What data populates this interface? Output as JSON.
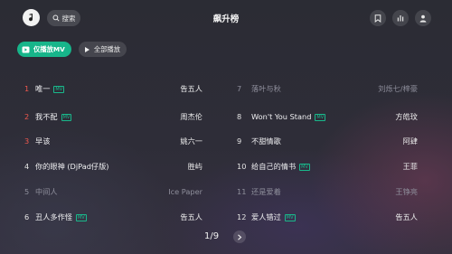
{
  "header": {
    "title": "飙升榜",
    "search_label": "搜索"
  },
  "controls": {
    "mv_only_label": "仅播放MV",
    "play_all_label": "全部播放"
  },
  "mv_badge": "MV",
  "colors": {
    "accent": "#17b58a",
    "hot_rank": "#f0584e",
    "dim_text": "#8f8f9c"
  },
  "songs_left": [
    {
      "rank": "1",
      "title": "唯一",
      "artist": "告五人",
      "mv": true,
      "dim": false
    },
    {
      "rank": "2",
      "title": "我不配",
      "artist": "周杰伦",
      "mv": true,
      "dim": false
    },
    {
      "rank": "3",
      "title": "早该",
      "artist": "姚六一",
      "mv": false,
      "dim": false
    },
    {
      "rank": "4",
      "title": "你的眼神 (DjPad仔版)",
      "artist": "胜屿",
      "mv": false,
      "dim": false
    },
    {
      "rank": "5",
      "title": "中间人",
      "artist": "Ice Paper",
      "mv": false,
      "dim": true
    },
    {
      "rank": "6",
      "title": "丑人多作怪",
      "artist": "告五人",
      "mv": true,
      "dim": false
    }
  ],
  "songs_right": [
    {
      "rank": "7",
      "title": "落叶与秋",
      "artist": "刘烁七/梓豪",
      "mv": false,
      "dim": true
    },
    {
      "rank": "8",
      "title": "Won't You Stand",
      "artist": "方皓玟",
      "mv": true,
      "dim": false
    },
    {
      "rank": "9",
      "title": "不甜情歌",
      "artist": "阿肆",
      "mv": false,
      "dim": false
    },
    {
      "rank": "10",
      "title": "给自己的情书",
      "artist": "王菲",
      "mv": true,
      "dim": false
    },
    {
      "rank": "11",
      "title": "还是爱着",
      "artist": "王铮亮",
      "mv": false,
      "dim": true
    },
    {
      "rank": "12",
      "title": "爱人错过",
      "artist": "告五人",
      "mv": true,
      "dim": false
    }
  ],
  "pagination": {
    "text": "1/9"
  }
}
